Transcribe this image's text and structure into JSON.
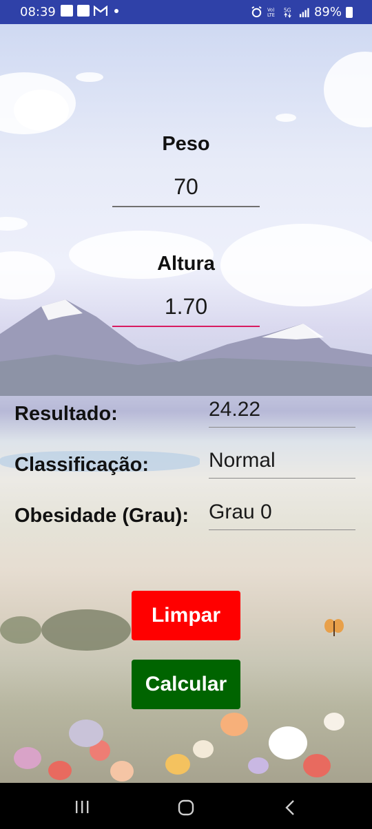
{
  "status_bar": {
    "time": "08:39",
    "battery": "89%"
  },
  "form": {
    "peso_label": "Peso",
    "peso_value": "70",
    "altura_label": "Altura",
    "altura_value": "1.70"
  },
  "results": [
    {
      "label": "Resultado:",
      "value": "24.22"
    },
    {
      "label": "Classificação:",
      "value": "Normal"
    },
    {
      "label": "Obesidade (Grau):",
      "value": "Grau 0"
    }
  ],
  "buttons": {
    "limpar_label": "Limpar",
    "limpar_color": "#ff0000",
    "calcular_label": "Calcular",
    "calcular_color": "#006400"
  },
  "icons": {
    "status_left": [
      "image-icon",
      "checkbox-icon",
      "gmail-icon"
    ],
    "status_right": [
      "alarm-icon",
      "volte-icon",
      "5g-icon",
      "signal-icon",
      "battery-icon"
    ],
    "nav": [
      "recent-apps-icon",
      "home-icon",
      "back-icon"
    ]
  }
}
